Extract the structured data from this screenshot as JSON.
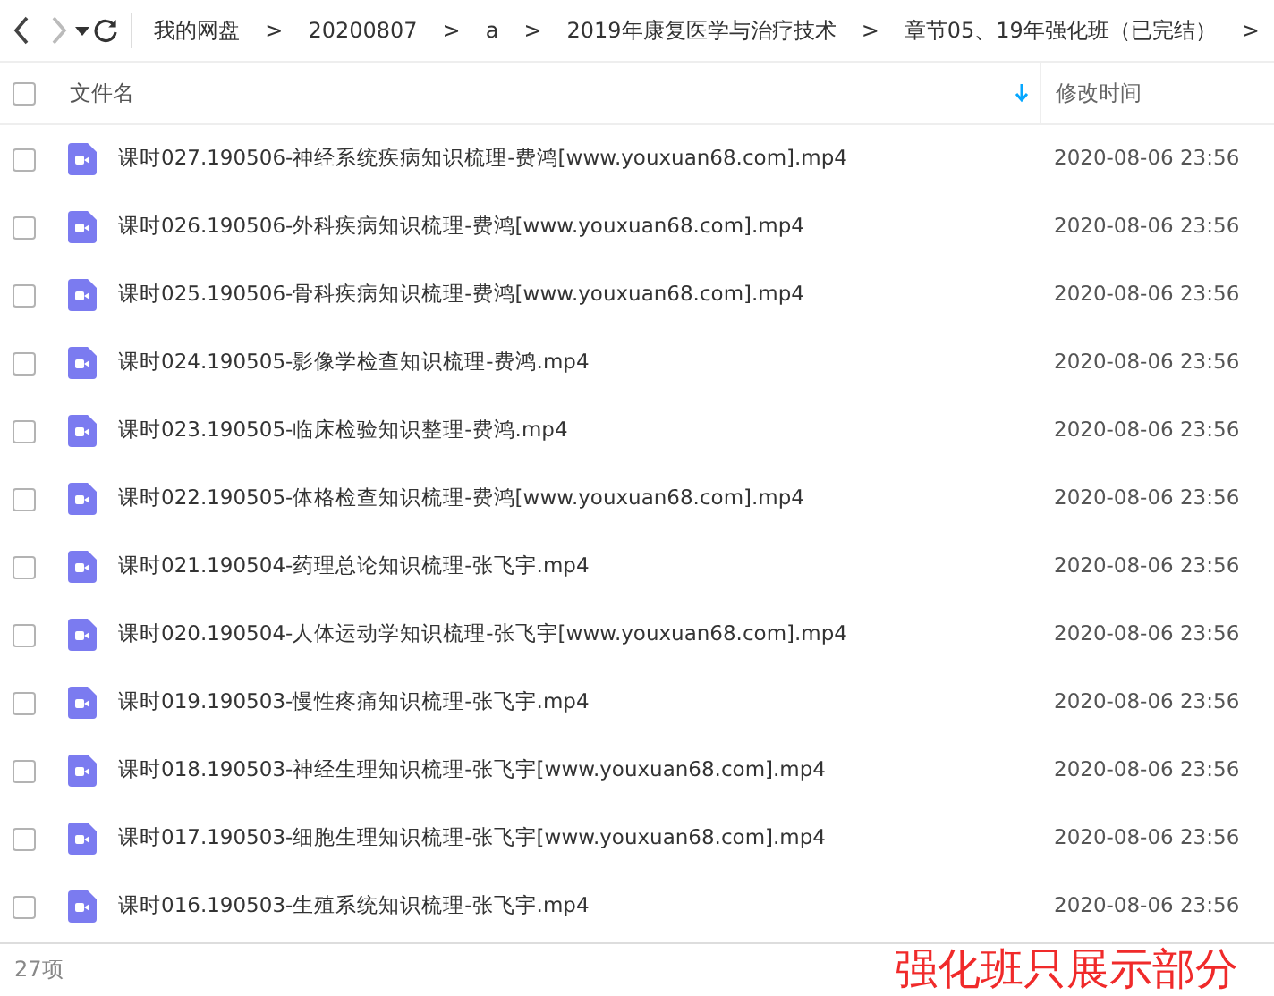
{
  "toolbar": {
    "breadcrumbs": [
      "我的网盘",
      "20200807",
      "a",
      "2019年康复医学与治疗技术",
      "章节05、19年强化班（已完结）"
    ],
    "separator": ">"
  },
  "table": {
    "columns": [
      {
        "label": "文件名",
        "sorted": true
      },
      {
        "label": "修改时间",
        "sorted": false
      }
    ],
    "all_checked": false,
    "rows": [
      {
        "name": "课时027.190506-神经系统疾病知识梳理-费鸿[www.youxuan68.com].mp4",
        "modified": "2020-08-06 23:56",
        "checked": false
      },
      {
        "name": "课时026.190506-外科疾病知识梳理-费鸿[www.youxuan68.com].mp4",
        "modified": "2020-08-06 23:56",
        "checked": false
      },
      {
        "name": "课时025.190506-骨科疾病知识梳理-费鸿[www.youxuan68.com].mp4",
        "modified": "2020-08-06 23:56",
        "checked": false
      },
      {
        "name": "课时024.190505-影像学检查知识梳理-费鸿.mp4",
        "modified": "2020-08-06 23:56",
        "checked": false
      },
      {
        "name": "课时023.190505-临床检验知识整理-费鸿.mp4",
        "modified": "2020-08-06 23:56",
        "checked": false
      },
      {
        "name": "课时022.190505-体格检查知识梳理-费鸿[www.youxuan68.com].mp4",
        "modified": "2020-08-06 23:56",
        "checked": false
      },
      {
        "name": "课时021.190504-药理总论知识梳理-张飞宇.mp4",
        "modified": "2020-08-06 23:56",
        "checked": false
      },
      {
        "name": "课时020.190504-人体运动学知识梳理-张飞宇[www.youxuan68.com].mp4",
        "modified": "2020-08-06 23:56",
        "checked": false
      },
      {
        "name": "课时019.190503-慢性疼痛知识梳理-张飞宇.mp4",
        "modified": "2020-08-06 23:56",
        "checked": false
      },
      {
        "name": "课时018.190503-神经生理知识梳理-张飞宇[www.youxuan68.com].mp4",
        "modified": "2020-08-06 23:56",
        "checked": false
      },
      {
        "name": "课时017.190503-细胞生理知识梳理-张飞宇[www.youxuan68.com].mp4",
        "modified": "2020-08-06 23:56",
        "checked": false
      },
      {
        "name": "课时016.190503-生殖系统知识梳理-张飞宇.mp4",
        "modified": "2020-08-06 23:56",
        "checked": false
      }
    ]
  },
  "status_bar": {
    "count": "27项"
  },
  "overlay_note": "强化班只展示部分"
}
